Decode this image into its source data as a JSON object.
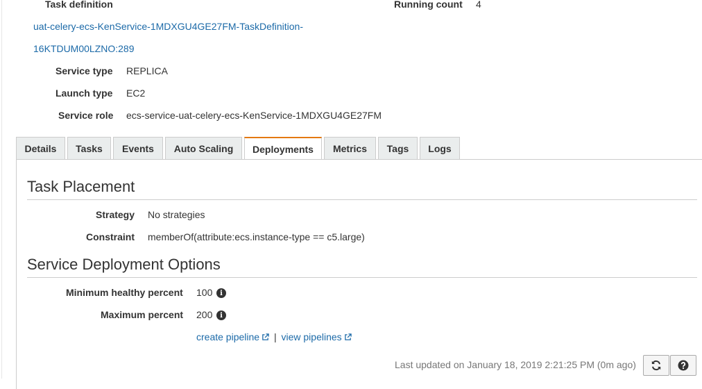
{
  "service": {
    "task_definition_label": "Task definition",
    "task_definition_link_line1": "uat-celery-ecs-KenService-1MDXGU4GE27FM-TaskDefinition-",
    "task_definition_link_line2": "16KTDUM00LZNO:289",
    "running_count_label": "Running count",
    "running_count_value": "4",
    "service_type_label": "Service type",
    "service_type_value": "REPLICA",
    "launch_type_label": "Launch type",
    "launch_type_value": "EC2",
    "service_role_label": "Service role",
    "service_role_value": "ecs-service-uat-celery-ecs-KenService-1MDXGU4GE27FM"
  },
  "tabs": [
    {
      "label": "Details"
    },
    {
      "label": "Tasks"
    },
    {
      "label": "Events"
    },
    {
      "label": "Auto Scaling"
    },
    {
      "label": "Deployments",
      "active": true
    },
    {
      "label": "Metrics"
    },
    {
      "label": "Tags"
    },
    {
      "label": "Logs"
    }
  ],
  "task_placement": {
    "title": "Task Placement",
    "strategy_label": "Strategy",
    "strategy_value": "No strategies",
    "constraint_label": "Constraint",
    "constraint_value": "memberOf(attribute:ecs.instance-type == c5.large)"
  },
  "deployment_options": {
    "title": "Service Deployment Options",
    "min_healthy_label": "Minimum healthy percent",
    "min_healthy_value": "100",
    "max_percent_label": "Maximum percent",
    "max_percent_value": "200",
    "create_pipeline_link": "create pipeline",
    "separator": "|",
    "view_pipelines_link": "view pipelines"
  },
  "footer": {
    "last_updated": "Last updated on January 18, 2019 2:21:25 PM (0m ago)",
    "refresh_icon": "refresh-icon",
    "help_icon": "help-icon"
  },
  "colors": {
    "link": "#1c6aa8",
    "active_tab_accent": "#e47911",
    "tab_bg": "#eaeded"
  }
}
